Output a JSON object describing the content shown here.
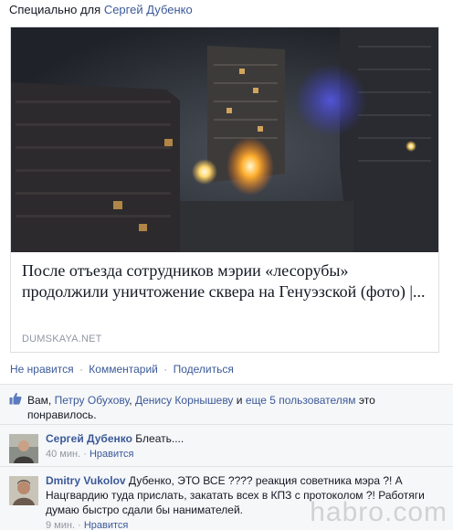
{
  "header": {
    "prefix": "Специально для",
    "recipient": "Сергей Дубенко"
  },
  "card": {
    "title": "После отъезда сотрудников мэрии «лесорубы» продолжили уничтожение сквера на Генуэзской (фото) |...",
    "source": "DUMSKAYA.NET"
  },
  "actions": {
    "like": "Не нравится",
    "comment": "Комментарий",
    "share": "Поделиться",
    "separator": "·"
  },
  "likes": {
    "you": "Вам,",
    "person1": "Петру Обухову",
    "comma": ",",
    "person2": "Денису Корнышеву",
    "and": "и",
    "others": "еще 5 пользователям",
    "suffix": "это понравилось."
  },
  "comments": [
    {
      "author": "Сергей Дубенко",
      "text": "Блеать....",
      "time": "40 мин.",
      "action": "Нравится"
    },
    {
      "author": "Dmitry Vukolov",
      "text": "Дубенко, ЭТО ВСЕ ???? реакция советника мэра ?! А Нацгвардию туда прислать, закатать всех в КПЗ с протоколом ?! Работяги думаю быстро сдали бы нанимателей.",
      "time": "9 мин.",
      "action": "Нравится"
    }
  ],
  "watermark": "habro.com"
}
